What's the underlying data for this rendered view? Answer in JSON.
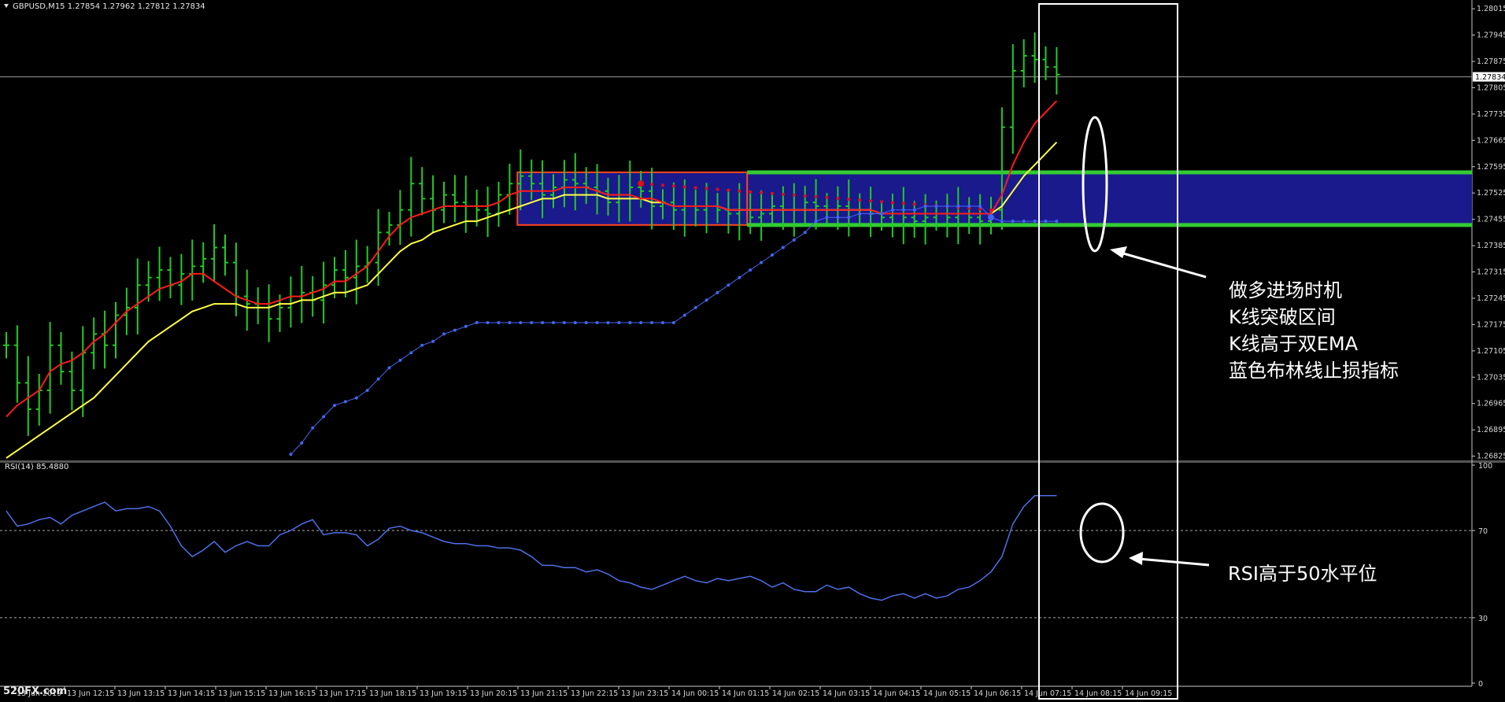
{
  "window": {
    "symbol_header": "GBPUSD,M15  1.27854 1.27962 1.27812 1.27834",
    "rsi_header": "RSI(14) 85.4880",
    "watermark": "520FX.com"
  },
  "annotations": {
    "entry_lines": [
      "做多进场时机",
      "K线突破区间",
      "K线高于双EMA",
      "蓝色布林线止损指标"
    ],
    "rsi_note": "RSI高于50水平位"
  },
  "colors": {
    "background": "#000000",
    "bars": "#22cc22",
    "ema_fast": "#ff1a1a",
    "ema_slow": "#ffff44",
    "stop_dots": "#4466ee",
    "red_dots": "#dd1111",
    "range_fill": "#1a1a8c",
    "range_border": "#ff4422",
    "range_lines": "#33cc33",
    "rsi_line": "#4f6fe8",
    "axis": "#c8c8c8",
    "frame": "#ffffff"
  },
  "chart_data": [
    {
      "type": "line",
      "title": "GBPUSD,M15",
      "ohlc_header": {
        "open": 1.27854,
        "high": 1.27962,
        "low": 1.27812,
        "close": 1.27834
      },
      "current_price_label": "1.27834",
      "current_price": 1.27834,
      "price_ticks": [
        "1.28015",
        "1.27945",
        "1.27875",
        "1.27805",
        "1.27735",
        "1.27665",
        "1.27595",
        "1.27525",
        "1.27455",
        "1.27385",
        "1.27315",
        "1.27245",
        "1.27175",
        "1.27105",
        "1.27035",
        "1.26965",
        "1.26895",
        "1.26825"
      ],
      "ylim": [
        1.2682,
        1.2803
      ],
      "time_ticks": [
        "13 Jun 2019",
        "13 Jun 12:15",
        "13 Jun 13:15",
        "13 Jun 14:15",
        "13 Jun 15:15",
        "13 Jun 16:15",
        "13 Jun 17:15",
        "13 Jun 18:15",
        "13 Jun 19:15",
        "13 Jun 20:15",
        "13 Jun 21:15",
        "13 Jun 22:15",
        "13 Jun 23:15",
        "14 Jun 00:15",
        "14 Jun 01:15",
        "14 Jun 02:15",
        "14 Jun 03:15",
        "14 Jun 04:15",
        "14 Jun 05:15",
        "14 Jun 06:15",
        "14 Jun 07:15",
        "14 Jun 08:15",
        "14 Jun 09:15"
      ],
      "bar_count": 97,
      "series": [
        {
          "kind": "ohlc",
          "values": [
            1.2712,
            1.2702,
            1.2695,
            1.27,
            1.2712,
            1.2705,
            1.27,
            1.271,
            1.2715,
            1.2712,
            1.272,
            1.2722,
            1.2728,
            1.273,
            1.2732,
            1.2728,
            1.2731,
            1.2733,
            1.2735,
            1.2738,
            1.2734,
            1.2725,
            1.2723,
            1.2722,
            1.2719,
            1.2722,
            1.2725,
            1.2726,
            1.2724,
            1.2728,
            1.2732,
            1.273,
            1.2733,
            1.2734,
            1.2742,
            1.2744,
            1.2748,
            1.2755,
            1.2751,
            1.2748,
            1.2752,
            1.275,
            1.2749,
            1.2748,
            1.2747,
            1.2752,
            1.2755,
            1.2757,
            1.2755,
            1.2752,
            1.2754,
            1.2756,
            1.2755,
            1.2754,
            1.2753,
            1.275,
            1.2752,
            1.2754,
            1.2753,
            1.2749,
            1.275,
            1.2748,
            1.2749,
            1.2748,
            1.2749,
            1.2748,
            1.2747,
            1.2748,
            1.2746,
            1.2747,
            1.2749,
            1.2748,
            1.2748,
            1.275,
            1.2749,
            1.2748,
            1.2749,
            1.2748,
            1.2748,
            1.2747,
            1.2746,
            1.2747,
            1.2746,
            1.2745,
            1.2746,
            1.2747,
            1.2746,
            1.2747,
            1.2746,
            1.2745,
            1.2748,
            1.277,
            1.2785,
            1.2789,
            1.2788,
            1.2786,
            1.2784
          ]
        },
        {
          "kind": "ema_fast",
          "values": [
            1.2693,
            1.2696,
            1.2698,
            1.27,
            1.2705,
            1.2707,
            1.2708,
            1.271,
            1.2713,
            1.2715,
            1.2718,
            1.2721,
            1.2723,
            1.2725,
            1.2727,
            1.2728,
            1.2729,
            1.2731,
            1.2731,
            1.2729,
            1.2727,
            1.2725,
            1.2724,
            1.2723,
            1.2723,
            1.2724,
            1.2725,
            1.2725,
            1.2726,
            1.2727,
            1.2729,
            1.2729,
            1.2731,
            1.2733,
            1.2737,
            1.2741,
            1.2744,
            1.2746,
            1.2747,
            1.2748,
            1.2749,
            1.2749,
            1.2749,
            1.2749,
            1.2749,
            1.275,
            1.2752,
            1.2753,
            1.2753,
            1.2753,
            1.2753,
            1.2754,
            1.2754,
            1.2754,
            1.2753,
            1.2752,
            1.2752,
            1.2752,
            1.2751,
            1.2751,
            1.275,
            1.2749,
            1.2749,
            1.2749,
            1.2749,
            1.2749,
            1.2748,
            1.2748,
            1.2748,
            1.2748,
            1.2748,
            1.2748,
            1.2748,
            1.2748,
            1.2748,
            1.2748,
            1.2748,
            1.2748,
            1.2748,
            1.2748,
            1.2747,
            1.2747,
            1.2747,
            1.2747,
            1.2747,
            1.2747,
            1.2747,
            1.2747,
            1.2747,
            1.2747,
            1.2747,
            1.2752,
            1.276,
            1.2766,
            1.2771,
            1.2774,
            1.2777
          ]
        },
        {
          "kind": "ema_slow",
          "values": [
            1.2682,
            1.2684,
            1.2686,
            1.2688,
            1.269,
            1.2692,
            1.2694,
            1.2696,
            1.2698,
            1.2701,
            1.2704,
            1.2707,
            1.271,
            1.2713,
            1.2715,
            1.2717,
            1.2719,
            1.2721,
            1.2722,
            1.2723,
            1.2723,
            1.2723,
            1.2722,
            1.2722,
            1.2722,
            1.2723,
            1.2723,
            1.2724,
            1.2724,
            1.2725,
            1.2726,
            1.2726,
            1.2727,
            1.2728,
            1.2731,
            1.2734,
            1.2737,
            1.2739,
            1.274,
            1.2742,
            1.2743,
            1.2744,
            1.2745,
            1.2745,
            1.2746,
            1.2747,
            1.2748,
            1.2749,
            1.275,
            1.2751,
            1.2751,
            1.2752,
            1.2752,
            1.2752,
            1.2752,
            1.2751,
            1.2751,
            1.2751,
            1.2751,
            1.275,
            1.275,
            1.2749,
            1.2749,
            1.2749,
            1.2749,
            1.2749,
            1.2748,
            1.2748,
            1.2748,
            1.2748,
            1.2748,
            1.2748,
            1.2748,
            1.2748,
            1.2748,
            1.2748,
            1.2748,
            1.2748,
            1.2748,
            1.2748,
            1.2747,
            1.2747,
            1.2747,
            1.2747,
            1.2747,
            1.2747,
            1.2747,
            1.2747,
            1.2747,
            1.2747,
            1.2747,
            1.2749,
            1.2753,
            1.2757,
            1.276,
            1.2763,
            1.2766
          ]
        },
        {
          "kind": "stop_dots",
          "values": [
            null,
            null,
            null,
            null,
            null,
            null,
            null,
            null,
            null,
            null,
            null,
            null,
            null,
            null,
            null,
            null,
            null,
            null,
            null,
            null,
            null,
            null,
            null,
            null,
            null,
            null,
            1.2683,
            1.2686,
            1.269,
            1.2693,
            1.2696,
            1.2697,
            1.2698,
            1.27,
            1.2703,
            1.2706,
            1.2708,
            1.271,
            1.2712,
            1.2713,
            1.2715,
            1.2716,
            1.2717,
            1.2718,
            1.2718,
            1.2718,
            1.2718,
            1.2718,
            1.2718,
            1.2718,
            1.2718,
            1.2718,
            1.2718,
            1.2718,
            1.2718,
            1.2718,
            1.2718,
            1.2718,
            1.2718,
            1.2718,
            1.2718,
            1.2718,
            1.272,
            1.2722,
            1.2724,
            1.2726,
            1.2728,
            1.273,
            1.2732,
            1.2734,
            1.2736,
            1.2738,
            1.274,
            1.2742,
            1.2745,
            1.2746,
            1.2746,
            1.2746,
            1.2747,
            1.2747,
            1.2747,
            1.2748,
            1.2748,
            1.2748,
            1.2749,
            1.2749,
            1.2749,
            1.2749,
            1.2749,
            1.2749,
            1.2746,
            1.2745,
            1.2745,
            1.2745,
            1.2745,
            1.2745,
            1.2745
          ]
        }
      ],
      "range_box": {
        "y_top": 1.2758,
        "y_bottom": 1.2744
      },
      "range_lines": {
        "upper": 1.2758,
        "lower": 1.2744
      },
      "red_dots": {
        "y_start": 1.2755,
        "y_end": 1.2748
      }
    },
    {
      "type": "line",
      "title": "RSI(14)",
      "header_value": 85.488,
      "ylim": [
        0,
        100
      ],
      "levels": [
        30,
        70
      ],
      "y_ticks": [
        "100",
        "70",
        "30",
        "0"
      ],
      "values": [
        79,
        72,
        73,
        75,
        76,
        73,
        77,
        79,
        81,
        83,
        79,
        80,
        80,
        81,
        79,
        72,
        63,
        58,
        61,
        65,
        60,
        63,
        65,
        63,
        63,
        68,
        70,
        73,
        75,
        68,
        69,
        69,
        68,
        63,
        66,
        71,
        72,
        70,
        69,
        67,
        65,
        64,
        64,
        63,
        63,
        62,
        62,
        61,
        58,
        54,
        54,
        53,
        53,
        51,
        52,
        50,
        47,
        46,
        44,
        43,
        45,
        47,
        49,
        47,
        46,
        48,
        47,
        48,
        49,
        47,
        44,
        46,
        43,
        42,
        42,
        45,
        43,
        44,
        41,
        39,
        38,
        40,
        41,
        39,
        41,
        39,
        40,
        43,
        44,
        47,
        51,
        58,
        73,
        81,
        86,
        86,
        86
      ]
    }
  ]
}
